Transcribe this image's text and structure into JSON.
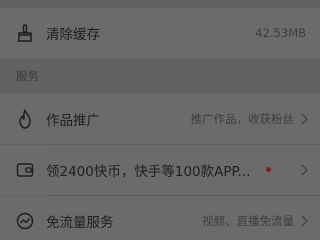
{
  "rows": {
    "clear_cache": {
      "label": "清除缓存",
      "detail": "42.53MB",
      "icon": "broom-icon"
    },
    "promote": {
      "label": "作品推广",
      "detail": "推广作品，收获粉丝",
      "icon": "flame-icon"
    },
    "coins": {
      "label": "领2400快币，快手等100款APP...",
      "detail": "",
      "icon": "wallet-icon"
    },
    "data_free": {
      "label": "免流量服务",
      "detail": "视频、直播免流量",
      "icon": "speed-icon"
    }
  },
  "section": {
    "services_title": "服务"
  },
  "colors": {
    "background": "#626262",
    "row_background": "#6b6b6b",
    "notification_dot": "#7a1f1f"
  }
}
